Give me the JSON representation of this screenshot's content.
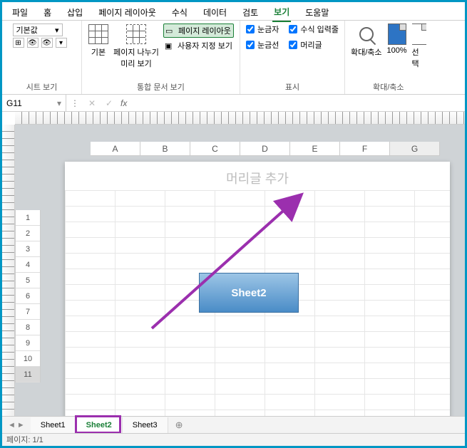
{
  "menu": {
    "items": [
      "파일",
      "홈",
      "삽입",
      "페이지 레이아웃",
      "수식",
      "데이터",
      "검토",
      "보기",
      "도움말"
    ],
    "active_index": 7
  },
  "ribbon": {
    "sheet_view": {
      "dropdown": "기본값",
      "label": "시트 보기"
    },
    "workbook_views": {
      "normal": "기본",
      "page_break": "페이지 나누기 미리 보기",
      "page_layout": "페이지 레이아웃",
      "custom": "사용자 지정 보기",
      "label": "통합 문서 보기"
    },
    "show": {
      "ruler": "눈금자",
      "formula_bar": "수식 입력줄",
      "gridlines": "눈금선",
      "headings": "머리글",
      "label": "표시"
    },
    "zoom": {
      "zoom": "확대/축소",
      "hundred": "100%",
      "selection": "선택",
      "label": "확대/축소"
    }
  },
  "namebox": {
    "cell": "G11"
  },
  "formula_bar": {
    "fx": "fx",
    "value": ""
  },
  "columns": [
    "A",
    "B",
    "C",
    "D",
    "E",
    "F",
    "G"
  ],
  "rows": [
    "1",
    "2",
    "3",
    "4",
    "5",
    "6",
    "7",
    "8",
    "9",
    "10",
    "11"
  ],
  "header_placeholder": "머리글 추가",
  "shape_text": "Sheet2",
  "sheet_tabs": {
    "items": [
      "Sheet1",
      "Sheet2",
      "Sheet3"
    ],
    "active_index": 1
  },
  "new_sheet": "+",
  "status": "페이지: 1/1"
}
